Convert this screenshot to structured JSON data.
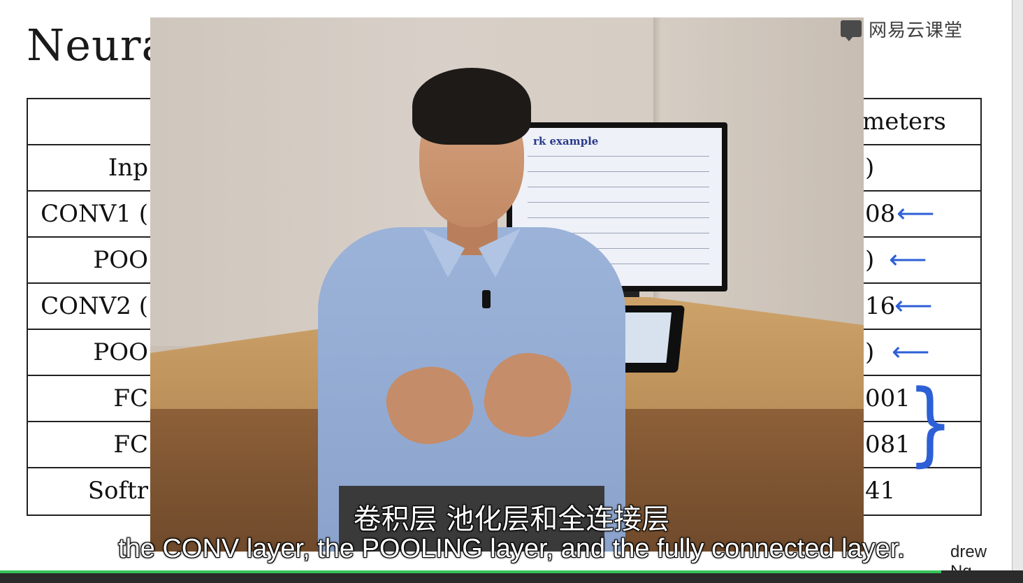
{
  "slide": {
    "title_visible": "Neura",
    "author_visible": "drew Ng",
    "header_right_visible": "meters",
    "rows": [
      {
        "left": "Inp",
        "right": ")",
        "arrow": ""
      },
      {
        "left": "CONV1 (",
        "right": "08",
        "arrow": "⟵"
      },
      {
        "left": "POO",
        "right": ")",
        "arrow": "⟵"
      },
      {
        "left": "CONV2  (",
        "right": "16",
        "arrow": "⟵"
      },
      {
        "left": "POO",
        "right": ")",
        "arrow": "⟵"
      },
      {
        "left": "FC",
        "right": "001",
        "arrow": ""
      },
      {
        "left": "FC",
        "right": "081",
        "arrow": ""
      },
      {
        "left": "Softr",
        "right": "41",
        "arrow": ""
      }
    ],
    "brace": "}"
  },
  "video": {
    "monitor_title_visible": "rk example"
  },
  "watermark": {
    "text": "网易云课堂",
    "icon": "chat-bubble-icon"
  },
  "subtitles": {
    "chinese": "卷积层 池化层和全连接层",
    "english": "the CONV layer, the POOLING layer, and the fully connected layer."
  },
  "player": {
    "progress": 0.92,
    "accent": "#37c45a"
  }
}
